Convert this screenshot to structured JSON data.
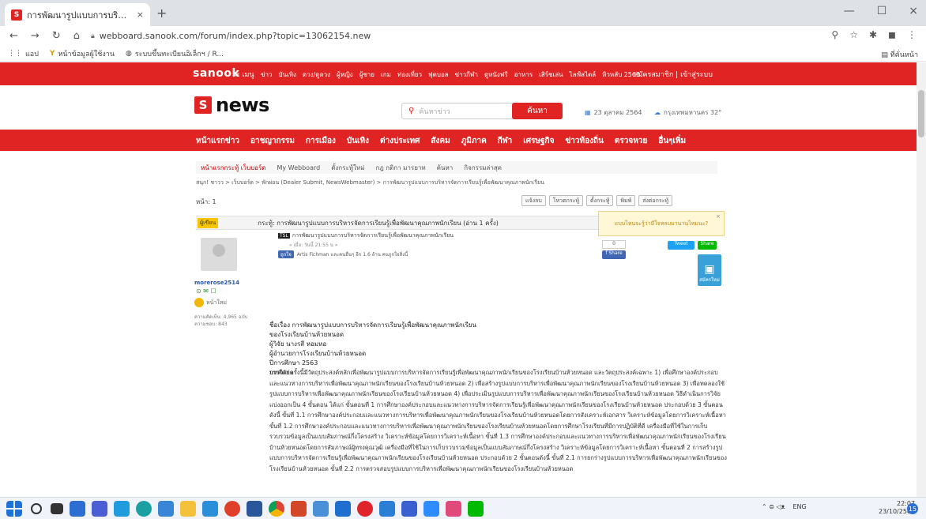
{
  "browser": {
    "tab_title": "การพัฒนารูปแบบการบริหารจัดการเรี",
    "tab_close": "×",
    "new_tab": "+",
    "url": "webboard.sanook.com/forum/index.php?topic=13062154.new",
    "window_minimize": "—",
    "window_maximize": "☐",
    "window_close": "×",
    "bookmarks": [
      {
        "label": "แอป"
      },
      {
        "label": "หน้าข้อมูลผู้ใช้งาน"
      },
      {
        "label": "ระบบขึ้นทะเบียนอิเล็กฯ / R..."
      }
    ],
    "bookmarks_other": "ที่คั่นหน้า"
  },
  "site": {
    "brand": "sanook",
    "menu_label": "≡ เมนู",
    "top_links": [
      "ข่าว",
      "บันเทิง",
      "ดวง/ดูดวง",
      "ผู้หญิง",
      "ผู้ชาย",
      "เกม",
      "ท่องเที่ยว",
      "ฟุตบอล",
      "ข่าวกีฬา",
      "ดูหนังฟรี",
      "อาหาร",
      "เสิร์ชเล่น",
      "ไลฟ์สไตล์",
      "หิวหลับ 2563"
    ],
    "top_login": "สมัครสมาชิก | เข้าสู่ระบบ",
    "logo_letter": "S",
    "logo_word": "news",
    "search_placeholder": "ค้นหาข่าว",
    "search_button": "ค้นหา",
    "date": "23 ตุลาคม 2564",
    "weather": "กรุงเทพมหานคร 32°",
    "categories": [
      "หน้าแรกข่าว",
      "อาชญากรรม",
      "การเมือง",
      "บันเทิง",
      "ต่างประเทศ",
      "สังคม",
      "ภูมิภาค",
      "กีฬา",
      "เศรษฐกิจ",
      "ข่าวท้องถิ่น",
      "ตรวจหวย",
      "อื่นๆเพิ่ม"
    ],
    "tools": [
      "หน้าแรกกระทู้ เว็บบอร์ด",
      "My Webboard",
      "ตั้งกระทู้ใหม่",
      "กฎ กติกา มารยาท",
      "ค้นหา",
      "กิจกรรมล่าสุด"
    ],
    "breadcrumb": "สนุก! ชาวว > เว็บบอร์ด > พักผ่อน (Dealer Submit, NewsWebmaster) > การพัฒนารูปแบบการบริหารจัดการเรียนรู้เพื่อพัฒนาคุณภาพนักเรียน",
    "page_label": "หน้า: 1",
    "actions": [
      "แจ้งลบ",
      "โหวตกระทู้",
      "ตั้งกระทู้",
      "พิมพ์",
      "ส่งต่อกระทู้"
    ],
    "post_bar_tag": "ผู้เขียน",
    "post_bar_title": "กระทู้: การพัฒนารูปแบบการบริหารจัดการเรียนรู้เพื่อพัฒนาคุณภาพนักเรียน (อ่าน 1 ครั้ง)",
    "author_name": "morerose2514",
    "author_icons": "⊙ ✉ ☐",
    "author_rank": "หน้าใหม่",
    "author_stats_line1": "ความคิดเห็น: 4,965 ฉบับ",
    "author_stats_line2": "ความชอบ: 843",
    "mini_title_tag": "TSL",
    "mini_title": "การพัฒนารูปแบบการบริหารจัดการเรียนรู้เพื่อพัฒนาคุณภาพนักเรียน",
    "mini_meta": "« เมื่อ: วันนี้ 21:55 น »",
    "fb_like_btn": "ถูกใจ",
    "fb_like_text": "Artis Fichman และคนอื่นๆ อีก 1.6 ล้าน คนถูกใจสิ่งนี้",
    "share_count": "0",
    "share_label": "f Share",
    "tweet_label": "Tweet",
    "line_label": "Share",
    "tooltip": "แบบไหนจะรู้ว่ามีใจหลบมานานไหมนะ?",
    "tooltip_close": "×",
    "float_label": "สมัครใหม่",
    "body_title_lines": [
      "ชื่อเรื่อง การพัฒนารูปแบบการบริหารจัดการเรียนรู้เพื่อพัฒนาคุณภาพนักเรียน",
      "ของโรงเรียนบ้านห้วยหนอด",
      "ผู้วิจัย นางรสี หอมหอ",
      "ผู้อำนวยการโรงเรียนบ้านห้วยหนอด",
      "ปีการศึกษา 2563",
      "บทคัดย่อ"
    ],
    "body_paragraph": "การวิจัยครั้งนี้มีวัตถุประสงค์หลักเพื่อพัฒนารูปแบบการบริหารจัดการเรียนรู้เพื่อพัฒนาคุณภาพนักเรียนของโรงเรียนบ้านห้วยหนอด และวัตถุประสงค์เฉพาะ 1) เพื่อศึกษาองค์ประกอบและแนวทางการบริหารเพื่อพัฒนาคุณภาพนักเรียนของโรงเรียนบ้านห้วยหนอด 2) เพื่อสร้างรูปแบบการบริหารเพื่อพัฒนาคุณภาพนักเรียนของโรงเรียนบ้านห้วยหนอด 3) เพื่อทดลองใช้รูปแบบการบริหารเพื่อพัฒนาคุณภาพนักเรียนของโรงเรียนบ้านห้วยหนอด 4) เพื่อประเมินรูปแบบการบริหารเพื่อพัฒนาคุณภาพนักเรียนของโรงเรียนบ้านห้วยหนอด วิธีดำเนินการวิจัย แบ่งออกเป็น 4 ขั้นตอน ได้แก่ ขั้นตอนที่ 1 การศึกษาองค์ประกอบและแนวทางการบริหารจัดการเรียนรู้เพื่อพัฒนาคุณภาพนักเรียนของโรงเรียนบ้านห้วยหนอด ประกอบด้วย 3 ขั้นตอนดังนี้ ขั้นที่ 1.1 การศึกษาองค์ประกอบและแนวทางการบริหารเพื่อพัฒนาคุณภาพนักเรียนของโรงเรียนบ้านห้วยหนอดโดยการสังเคราะห์เอกสาร วิเคราะห์ข้อมูลโดยการวิเคราะห์เนื้อหา ขั้นที่ 1.2 การศึกษาองค์ประกอบและแนวทางการบริหารเพื่อพัฒนาคุณภาพนักเรียนของโรงเรียนบ้านห้วยหนอดโดยการศึกษาโรงเรียนที่มีการปฏิบัติที่ดี เครื่องมือที่ใช้ในการเก็บรวบรวมข้อมูลเป็นแบบสัมภาษณ์กึ่งโครงสร้าง วิเคราะห์ข้อมูลโดยการวิเคราะห์เนื้อหา ขั้นที่ 1.3 การศึกษาองค์ประกอบและแนวทางการบริหารเพื่อพัฒนาคุณภาพนักเรียนของโรงเรียนบ้านห้วยหนอดโดยการสัมภาษณ์ผู้ทรงคุณวุฒิ เครื่องมือที่ใช้ในการเก็บรวบรวมข้อมูลเป็นแบบสัมภาษณ์กึ่งโครงสร้าง วิเคราะห์ข้อมูลโดยการวิเคราะห์เนื้อหา ขั้นตอนที่ 2 การสร้างรูปแบบการบริหารจัดการเรียนรู้เพื่อพัฒนาคุณภาพนักเรียนของโรงเรียนบ้านห้วยหนอด ประกอบด้วย 2 ขั้นตอนดังนี้ ขั้นที่ 2.1 การยกร่างรูปแบบการบริหารเพื่อพัฒนาคุณภาพนักเรียนของโรงเรียนบ้านห้วยหนอด ขั้นที่ 2.2 การตรวจสอบรูปแบบการบริหารเพื่อพัฒนาคุณภาพนักเรียนของโรงเรียนบ้านห้วยหนอด"
  },
  "taskbar": {
    "tray_lang": "ENG",
    "tray_icons": "⌃  ⊜ ◁ᴥ",
    "time": "22:07",
    "date": "23/10/2564",
    "notif_count": "15"
  },
  "colors": {
    "brand_red": "#e02424",
    "taskbar": "#f0f3f9"
  }
}
